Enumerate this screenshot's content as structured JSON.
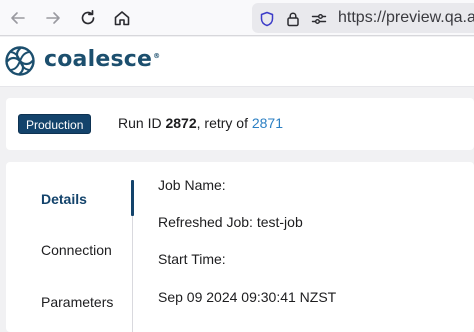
{
  "browser": {
    "url": "https://preview.qa.app"
  },
  "app": {
    "logo_text": "coalesce",
    "logo_mark": "®"
  },
  "run": {
    "environment_badge": "Production",
    "run_id_prefix": "Run ID ",
    "run_id": "2872",
    "retry_text": ", retry of ",
    "retry_of": "2871"
  },
  "details": {
    "tabs": [
      {
        "label": "Details",
        "active": true
      },
      {
        "label": "Connection",
        "active": false
      },
      {
        "label": "Parameters",
        "active": false
      }
    ],
    "fields": [
      "Job Name:",
      "Refreshed Job: test-job",
      "Start Time:",
      "Sep 09 2024 09:30:41 NZST"
    ]
  },
  "colors": {
    "brand": "#13436b",
    "link": "#2b7fc3",
    "logo": "#1c4f6e"
  }
}
